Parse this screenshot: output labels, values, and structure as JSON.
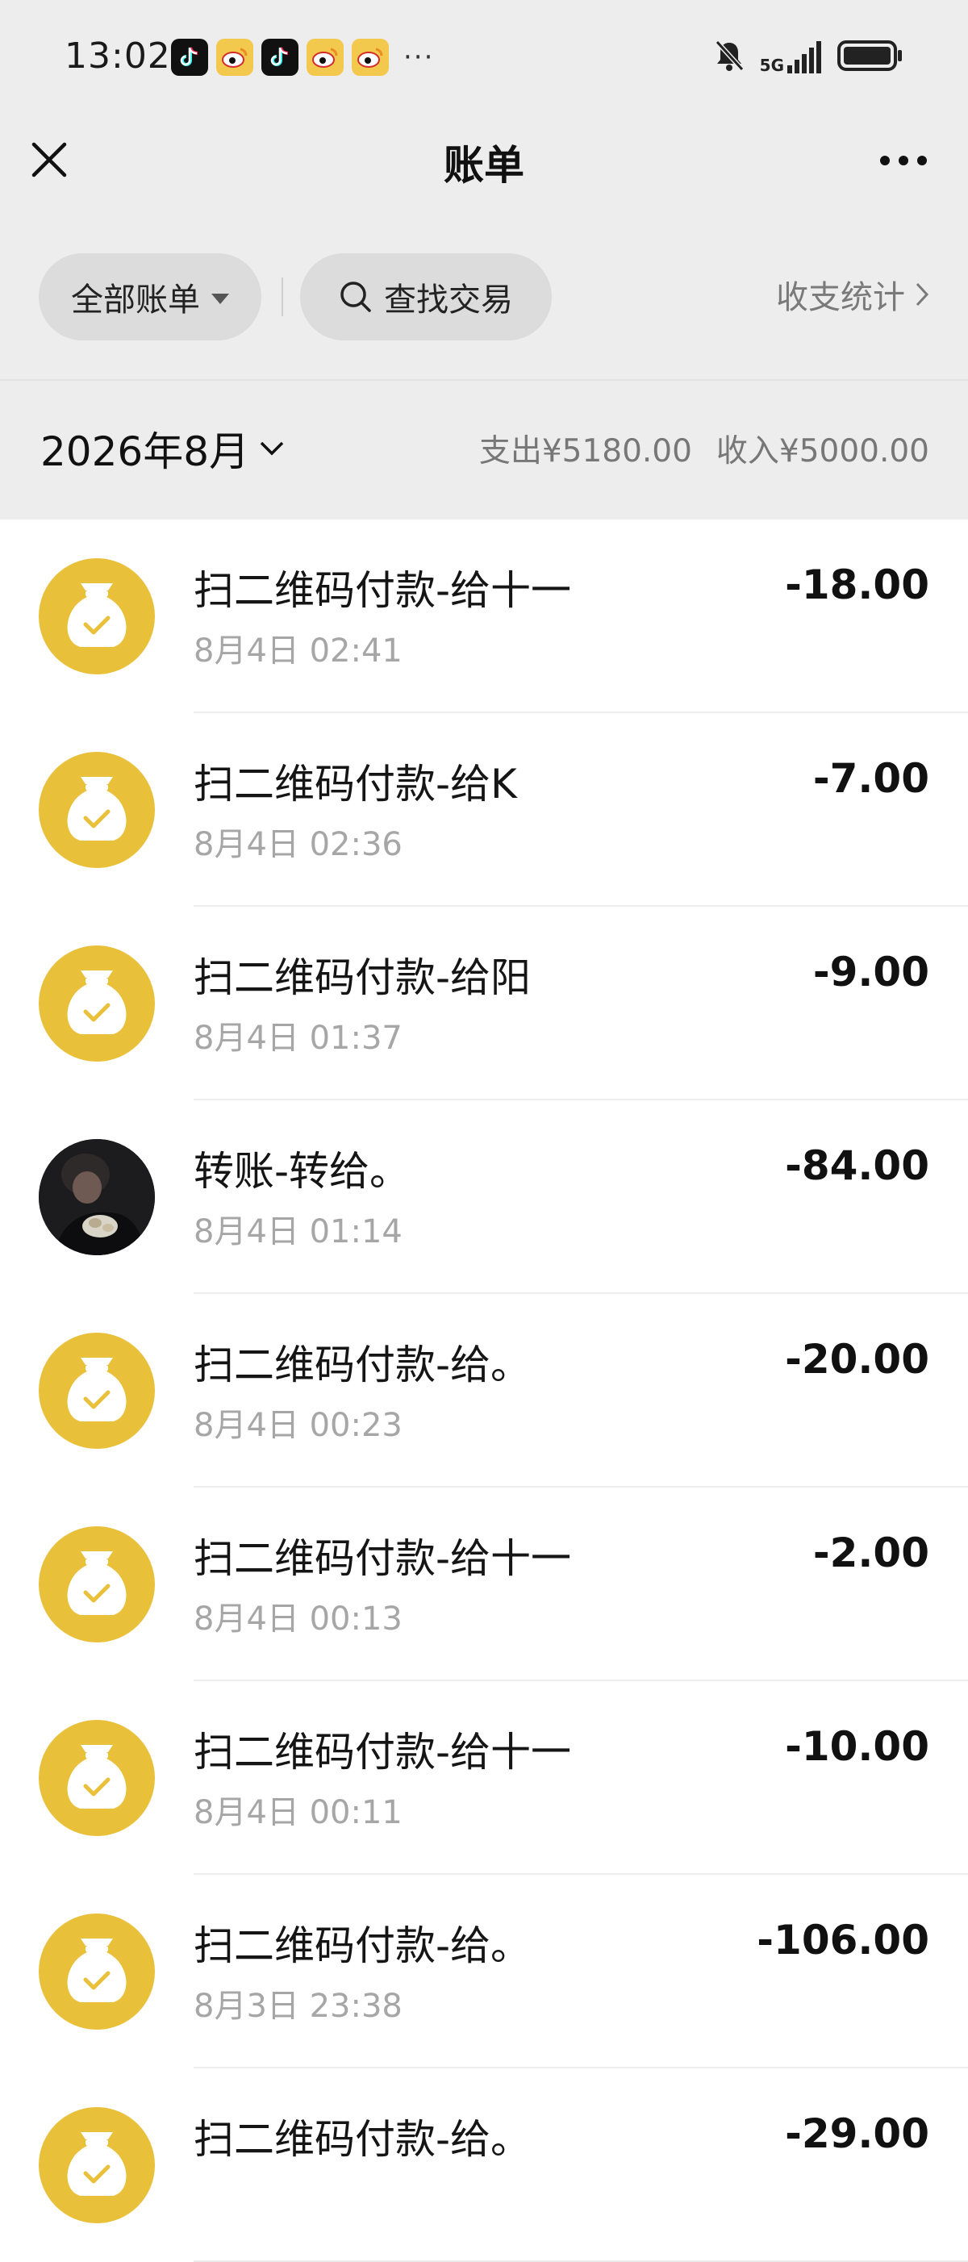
{
  "status_bar": {
    "time": "13:02",
    "notification_icons": [
      "tiktok-icon",
      "weibo-icon",
      "tiktok-icon",
      "weibo-icon",
      "weibo-icon"
    ],
    "more": "···",
    "network": "5G",
    "system_icons": [
      "mute-bell-icon",
      "signal-icon",
      "battery-icon"
    ]
  },
  "header": {
    "title": "账单"
  },
  "filters": {
    "all_bills": "全部账单",
    "search": "查找交易",
    "stats": "收支统计"
  },
  "summary": {
    "month": "2026年8月",
    "expense": "支出¥5180.00",
    "income": "收入¥5000.00"
  },
  "transactions": [
    {
      "title": "扫二维码付款-给十一",
      "time": "8月4日 02:41",
      "amount": "-18.00",
      "icon": "money-bag-icon"
    },
    {
      "title": "扫二维码付款-给K",
      "time": "8月4日 02:36",
      "amount": "-7.00",
      "icon": "money-bag-icon"
    },
    {
      "title": "扫二维码付款-给阳",
      "time": "8月4日 01:37",
      "amount": "-9.00",
      "icon": "money-bag-icon"
    },
    {
      "title": "转账-转给。",
      "time": "8月4日 01:14",
      "amount": "-84.00",
      "icon": "user-avatar"
    },
    {
      "title": "扫二维码付款-给。",
      "time": "8月4日 00:23",
      "amount": "-20.00",
      "icon": "money-bag-icon"
    },
    {
      "title": "扫二维码付款-给十一",
      "time": "8月4日 00:13",
      "amount": "-2.00",
      "icon": "money-bag-icon"
    },
    {
      "title": "扫二维码付款-给十一",
      "time": "8月4日 00:11",
      "amount": "-10.00",
      "icon": "money-bag-icon"
    },
    {
      "title": "扫二维码付款-给。",
      "time": "8月3日 23:38",
      "amount": "-106.00",
      "icon": "money-bag-icon"
    },
    {
      "title": "扫二维码付款-给。",
      "time": "",
      "amount": "-29.00",
      "icon": "money-bag-icon"
    }
  ],
  "colors": {
    "header_bg": "#ededed",
    "pill_bg": "#dcdcdc",
    "icon_yellow": "#e8c03a"
  }
}
